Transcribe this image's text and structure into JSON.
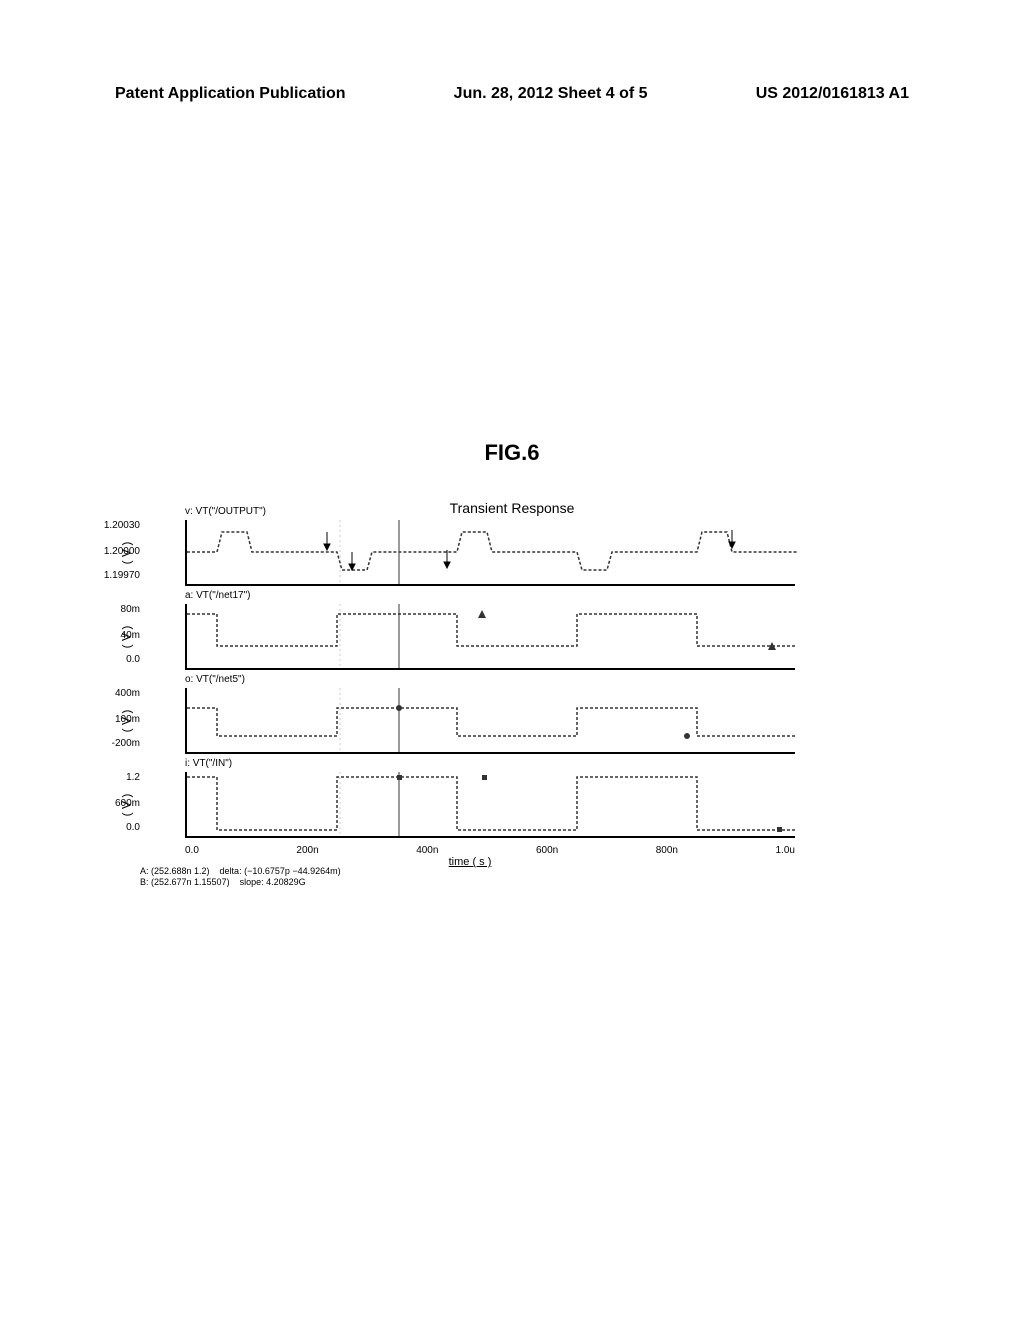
{
  "header": {
    "left": "Patent Application Publication",
    "center": "Jun. 28, 2012 Sheet 4 of 5",
    "right": "US 2012/0161813 A1"
  },
  "figure_title": "FIG.6",
  "chart_title": "Transient Response",
  "xlabel": "time ( s )",
  "footer": "A: (252.688n 1.2)    delta: (−10.6757p −44.9264m)\nB: (252.677n 1.15507)    slope: 4.20829G",
  "subplots": [
    {
      "label": "v: VT(\"/OUTPUT\")",
      "ylabel": "( V )"
    },
    {
      "label": "a: VT(\"/net17\")",
      "ylabel": "( V )"
    },
    {
      "label": "o: VT(\"/net5\")",
      "ylabel": "( V )"
    },
    {
      "label": "i: VT(\"/IN\")",
      "ylabel": "( V )"
    }
  ],
  "yticks": {
    "p1": [
      "1.20030",
      "1.20000",
      "1.19970"
    ],
    "p2": [
      "80m",
      "40m",
      "0.0"
    ],
    "p3": [
      "400m",
      "100m",
      "-200m"
    ],
    "p4": [
      "1.2",
      "600m",
      "0.0"
    ]
  },
  "xticks": [
    "0.0",
    "200n",
    "400n",
    "600n",
    "800n",
    "1.0u"
  ],
  "chart_data": [
    {
      "type": "line",
      "name": "VT(\"/OUTPUT\")",
      "x_unit": "s",
      "y_unit": "V",
      "ylim": [
        1.1997,
        1.2003
      ],
      "x": [
        0,
        5e-08,
        1e-07,
        2.5e-07,
        3e-07,
        4.5e-07,
        5e-07,
        6.5e-07,
        7e-07,
        8.5e-07,
        9e-07,
        1e-06
      ],
      "y": [
        1.2,
        1.20018,
        1.2,
        1.19974,
        1.2,
        1.20018,
        1.2,
        1.19974,
        1.2,
        1.20018,
        1.2,
        1.19974
      ]
    },
    {
      "type": "line",
      "name": "VT(\"/net17\")",
      "x_unit": "s",
      "y_unit": "V",
      "ylim": [
        0.0,
        0.08
      ],
      "x": [
        0,
        5e-08,
        5e-08,
        2.5e-07,
        2.5e-07,
        4.5e-07,
        4.5e-07,
        6.5e-07,
        6.5e-07,
        8.5e-07,
        8.5e-07,
        1e-06
      ],
      "y": [
        0.07,
        0.07,
        0.03,
        0.03,
        0.07,
        0.07,
        0.03,
        0.03,
        0.07,
        0.07,
        0.03,
        0.03
      ]
    },
    {
      "type": "line",
      "name": "VT(\"/net5\")",
      "x_unit": "s",
      "y_unit": "V",
      "ylim": [
        -0.2,
        0.4
      ],
      "x": [
        0,
        5e-08,
        5e-08,
        2.5e-07,
        2.5e-07,
        4.5e-07,
        4.5e-07,
        6.5e-07,
        6.5e-07,
        8.5e-07,
        8.5e-07,
        1e-06
      ],
      "y": [
        0.15,
        0.15,
        -0.1,
        -0.1,
        0.15,
        0.15,
        -0.1,
        -0.1,
        0.15,
        0.15,
        -0.1,
        -0.1
      ]
    },
    {
      "type": "line",
      "name": "VT(\"/IN\")",
      "x_unit": "s",
      "y_unit": "V",
      "ylim": [
        0.0,
        1.2
      ],
      "x": [
        0,
        5e-08,
        5e-08,
        2.5e-07,
        2.5e-07,
        4.5e-07,
        4.5e-07,
        6.5e-07,
        6.5e-07,
        8.5e-07,
        8.5e-07,
        1e-06
      ],
      "y": [
        1.2,
        1.2,
        0.0,
        0.0,
        1.2,
        1.2,
        0.0,
        0.0,
        1.2,
        1.2,
        0.0,
        0.0
      ]
    }
  ]
}
